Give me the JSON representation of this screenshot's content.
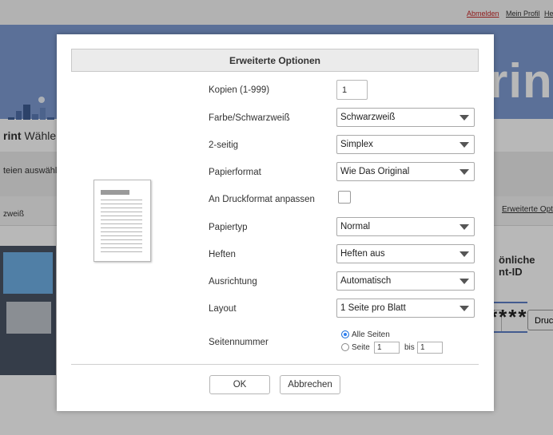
{
  "background": {
    "top_links": [
      {
        "label": "Abmelden",
        "color": "#c62828"
      },
      {
        "label": "Mein Profil",
        "color": "#333333"
      },
      {
        "label": "He",
        "color": "#333333"
      }
    ],
    "brand_partial": "rint",
    "app_title_bold": "rint",
    "app_title_rest": "Wähle",
    "files_label": "teien auswähle",
    "print_button_partial": "Druc",
    "color_mode_partial": "zweiß",
    "advanced_link_partial": "Erweiterte Opt",
    "personal_id_line1": "önliche",
    "personal_id_line2": "nt-ID",
    "masked_id": "****"
  },
  "dialog": {
    "title": "Erweiterte Optionen",
    "fields": {
      "copies": {
        "label": "Kopien (1-999)",
        "value": "1"
      },
      "color": {
        "label": "Farbe/Schwarzweiß",
        "value": "Schwarzweiß"
      },
      "duplex": {
        "label": "2-seitig",
        "value": "Simplex"
      },
      "paper_format": {
        "label": "Papierformat",
        "value": "Wie Das Original"
      },
      "fit_to_format": {
        "label": "An Druckformat anpassen"
      },
      "paper_type": {
        "label": "Papiertyp",
        "value": "Normal"
      },
      "staple": {
        "label": "Heften",
        "value": "Heften aus"
      },
      "orientation": {
        "label": "Ausrichtung",
        "value": "Automatisch"
      },
      "layout": {
        "label": "Layout",
        "value": "1 Seite pro Blatt"
      },
      "page_number": {
        "label": "Seitennummer",
        "all_pages_label": "Alle Seiten",
        "page_label": "Seite",
        "from_value": "1",
        "to_label": "bis",
        "to_value": "1"
      }
    },
    "ok_label": "OK",
    "cancel_label": "Abbrechen"
  },
  "colors": {
    "banner": "#7e9bd3",
    "radio_selected": "#2c7ff2",
    "logout_link": "#c62828"
  }
}
